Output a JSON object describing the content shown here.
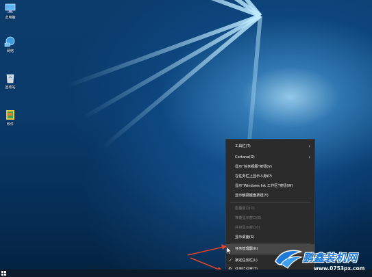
{
  "desktop_icons": [
    {
      "label": "此电脑",
      "icon": "computer-icon"
    },
    {
      "label": "网络",
      "icon": "network-icon"
    },
    {
      "label": "回收站",
      "icon": "recycle-bin-icon"
    },
    {
      "label": "软件",
      "icon": "folder-icon"
    }
  ],
  "context_menu": {
    "items": [
      {
        "label": "工具栏(T)",
        "submenu": true
      },
      {
        "label": "Cortana(O)",
        "submenu": true
      },
      {
        "label": "显示\"任务视图\"按钮(V)"
      },
      {
        "label": "在任务栏上显示人脉(P)"
      },
      {
        "label": "显示\"Windows Ink 工作区\"按钮(W)"
      },
      {
        "label": "显示触摸键盘按钮(Y)"
      },
      {
        "label": "层叠窗口(D)",
        "disabled": true
      },
      {
        "label": "堆叠显示窗口(E)",
        "disabled": true
      },
      {
        "label": "并排显示窗口(I)",
        "disabled": true
      },
      {
        "label": "显示桌面(S)"
      },
      {
        "label": "任务管理器(K)",
        "highlighted": true
      },
      {
        "label": "锁定任务栏(L)",
        "checked": true
      },
      {
        "label": "任务栏设置(T)",
        "icon": "gear-icon"
      }
    ]
  },
  "watermark": {
    "title": "鹏鑫装机网",
    "url": "www.0753px.com"
  },
  "colors": {
    "menu_bg": "#2b2b2b",
    "arrow": "#e0442c",
    "watermark_blue": "#1e7ad6"
  }
}
